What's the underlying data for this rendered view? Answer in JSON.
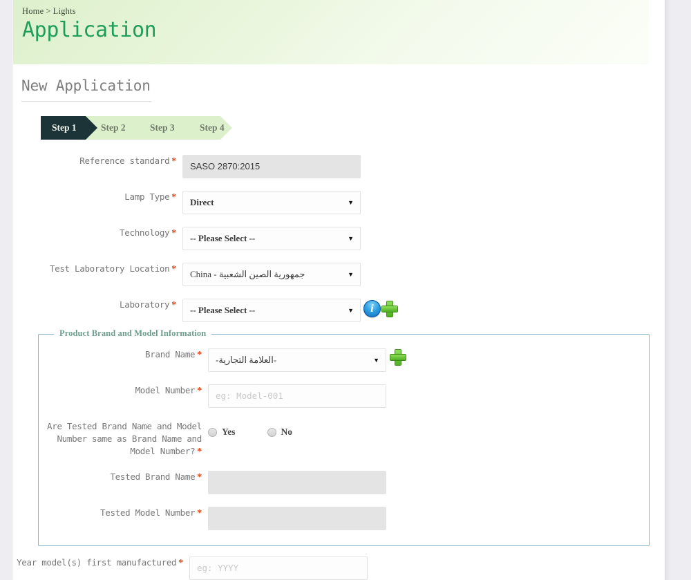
{
  "breadcrumb": {
    "home": "Home",
    "separator": ">",
    "current": "Lights"
  },
  "header": {
    "title": "Application"
  },
  "section": {
    "title": "New Application"
  },
  "steps": [
    {
      "label": "Step 1",
      "active": true
    },
    {
      "label": "Step 2",
      "active": false
    },
    {
      "label": "Step 3",
      "active": false
    },
    {
      "label": "Step 4",
      "active": false
    }
  ],
  "form": {
    "reference_standard": {
      "label": "Reference standard",
      "value": "SASO 2870:2015",
      "required": "*"
    },
    "lamp_type": {
      "label": "Lamp Type",
      "value": "Direct",
      "required": "*"
    },
    "technology": {
      "label": "Technology",
      "value": "-- Please Select --",
      "required": "*"
    },
    "test_lab_location": {
      "label": "Test Laboratory Location",
      "value": "China - جمهورية الصين الشعبية",
      "required": "*"
    },
    "laboratory": {
      "label": "Laboratory",
      "value": "-- Please Select --",
      "required": "*"
    }
  },
  "fieldset": {
    "legend": "Product Brand and Model Information",
    "brand_name": {
      "label": "Brand Name",
      "value": "-العلامة التجارية-",
      "required": "*"
    },
    "model_number": {
      "label": "Model Number",
      "value": "",
      "placeholder": "eg: Model-001",
      "required": "*"
    },
    "same_question": {
      "label": "Are Tested Brand Name and Model Number same as Brand Name and Model Number?",
      "required": "*",
      "options": [
        {
          "label": "Yes",
          "selected": false
        },
        {
          "label": "No",
          "selected": false
        }
      ]
    },
    "tested_brand_name": {
      "label": "Tested Brand Name",
      "value": "",
      "required": "*"
    },
    "tested_model_number": {
      "label": "Tested Model Number",
      "value": "",
      "required": "*"
    }
  },
  "tail": {
    "year_first_manufactured": {
      "label": "Year model(s) first manufactured",
      "value": "",
      "placeholder": "eg: YYYY",
      "required": "*"
    }
  },
  "icons": {
    "laboratory_info": "info-icon",
    "laboratory_add": "plus-icon",
    "brand_add": "plus-icon",
    "select_arrow": "▼"
  },
  "colors": {
    "accent_green": "#1f9e5a",
    "step_active_bg": "#1c3338",
    "step_track_bg": "#ddf0cc",
    "required_star": "#e04614",
    "fieldset_border": "#8ab4cc",
    "legend_text": "#6c9e8d"
  }
}
